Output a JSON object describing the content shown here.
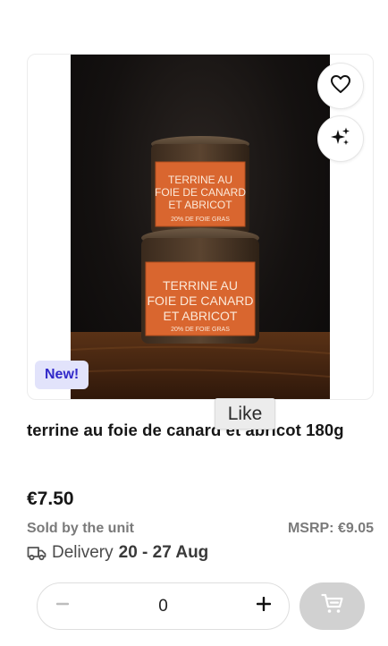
{
  "product": {
    "name": "terrine au foie de canard et abricot 180g",
    "badge": "New!",
    "price": "€7.50",
    "sold_by": "Sold by the unit",
    "msrp": "MSRP: €9.05",
    "delivery_label": "Delivery",
    "delivery_dates": "20 - 27 Aug",
    "image_label_lines": [
      "TERRINE AU",
      "FOIE DE CANARD",
      "ET ABRICOT",
      "20% DE FOIE GRAS"
    ]
  },
  "tooltip": {
    "text": "Like"
  },
  "quantity": {
    "value": "0"
  },
  "icons": {
    "like": "heart-icon",
    "ai": "sparkles-icon",
    "delivery": "truck-icon",
    "minus": "minus-icon",
    "plus": "plus-icon",
    "cart": "cart-icon"
  },
  "colors": {
    "badge_bg": "#e2e3fb",
    "badge_text": "#3129c9",
    "cart_button": "#d1d1d1",
    "label_orange": "#d9662f"
  }
}
